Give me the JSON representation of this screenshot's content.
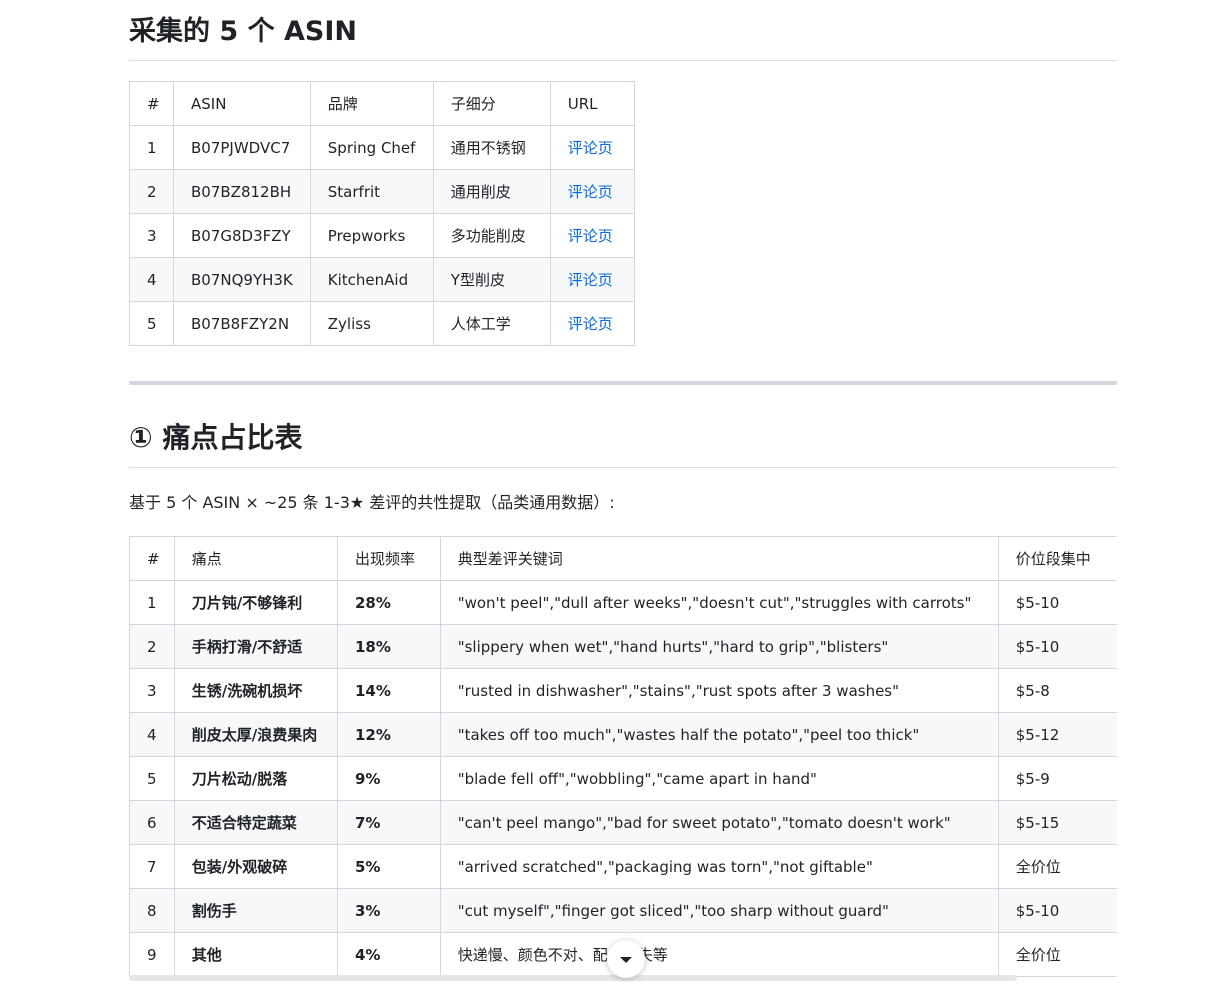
{
  "asin_section": {
    "title": "采集的 5 个 ASIN",
    "headers": [
      "#",
      "ASIN",
      "品牌",
      "子细分",
      "URL"
    ],
    "rows": [
      {
        "n": "1",
        "asin": "B07PJWDVC7",
        "brand": "Spring Chef",
        "sub": "通用不锈钢",
        "url": "评论页"
      },
      {
        "n": "2",
        "asin": "B07BZ812BH",
        "brand": "Starfrit",
        "sub": "通用削皮",
        "url": "评论页"
      },
      {
        "n": "3",
        "asin": "B07G8D3FZY",
        "brand": "Prepworks",
        "sub": "多功能削皮",
        "url": "评论页"
      },
      {
        "n": "4",
        "asin": "B07NQ9YH3K",
        "brand": "KitchenAid",
        "sub": "Y型削皮",
        "url": "评论页"
      },
      {
        "n": "5",
        "asin": "B07B8FZY2N",
        "brand": "Zyliss",
        "sub": "人体工学",
        "url": "评论页"
      }
    ]
  },
  "pain_section": {
    "title": "① 痛点占比表",
    "intro": "基于 5 个 ASIN × ~25 条 1-3★ 差评的共性提取（品类通用数据）:",
    "headers": [
      "#",
      "痛点",
      "出现频率",
      "典型差评关键词",
      "价位段集中",
      ""
    ],
    "rows": [
      {
        "n": "1",
        "pain": "刀片钝/不够锋利",
        "freq": "28%",
        "kw": "\"won't peel\",\"dull after weeks\",\"doesn't cut\",\"struggles with carrots\"",
        "price": "$5-10"
      },
      {
        "n": "2",
        "pain": "手柄打滑/不舒适",
        "freq": "18%",
        "kw": "\"slippery when wet\",\"hand hurts\",\"hard to grip\",\"blisters\"",
        "price": "$5-10"
      },
      {
        "n": "3",
        "pain": "生锈/洗碗机损坏",
        "freq": "14%",
        "kw": "\"rusted in dishwasher\",\"stains\",\"rust spots after 3 washes\"",
        "price": "$5-8"
      },
      {
        "n": "4",
        "pain": "削皮太厚/浪费果肉",
        "freq": "12%",
        "kw": "\"takes off too much\",\"wastes half the potato\",\"peel too thick\"",
        "price": "$5-12"
      },
      {
        "n": "5",
        "pain": "刀片松动/脱落",
        "freq": "9%",
        "kw": "\"blade fell off\",\"wobbling\",\"came apart in hand\"",
        "price": "$5-9"
      },
      {
        "n": "6",
        "pain": "不适合特定蔬菜",
        "freq": "7%",
        "kw": "\"can't peel mango\",\"bad for sweet potato\",\"tomato doesn't work\"",
        "price": "$5-15"
      },
      {
        "n": "7",
        "pain": "包装/外观破碎",
        "freq": "5%",
        "kw": "\"arrived scratched\",\"packaging was torn\",\"not giftable\"",
        "price": "全价位"
      },
      {
        "n": "8",
        "pain": "割伤手",
        "freq": "3%",
        "kw": "\"cut myself\",\"finger got sliced\",\"too sharp without guard\"",
        "price": "$5-10"
      },
      {
        "n": "9",
        "pain": "其他",
        "freq": "4%",
        "kw": "快递慢、颜色不对、配件丢失等",
        "price": "全价位"
      }
    ]
  },
  "icons": {
    "scroll_down": "chevron-down-icon"
  },
  "colors": {
    "link": "#0969da",
    "stripe": "#f6f8fa",
    "border": "#d0d7de"
  }
}
